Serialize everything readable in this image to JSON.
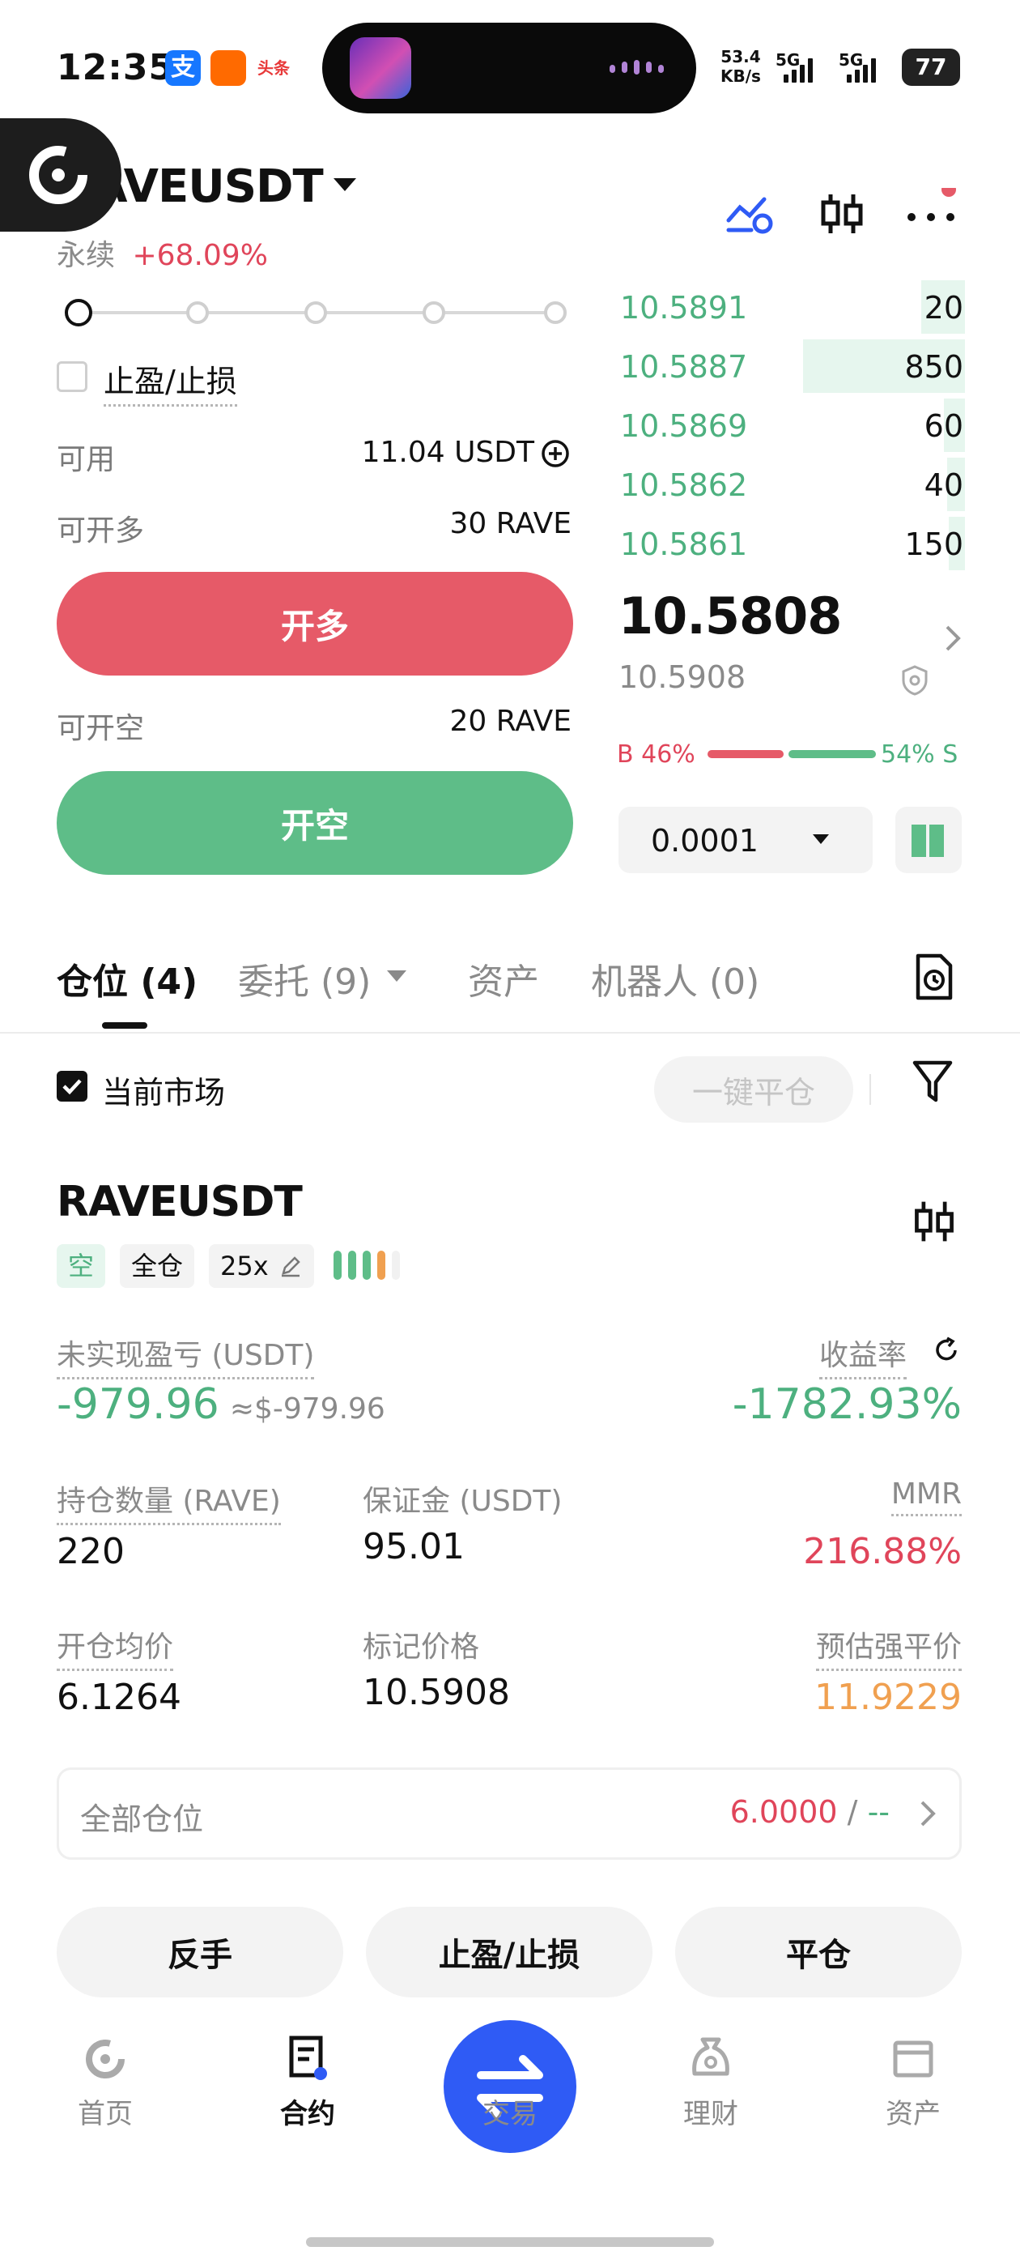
{
  "status_bar": {
    "time": "12:35",
    "net_speed_value": "53.4",
    "net_speed_unit": "KB/s",
    "signal1_label": "5G",
    "signal2_label": "5G",
    "battery": "77",
    "app_icons": [
      "alipay-icon",
      "taobao-icon",
      "toutiao-icon"
    ],
    "toutiao_label": "头条"
  },
  "header": {
    "pair": "RAVEUSDT",
    "contract_type": "永续",
    "change": "+68.09%"
  },
  "order_panel": {
    "tp_sl_label": "止盈/止损",
    "available_label": "可用",
    "available_value": "11.04 USDT",
    "can_long_label": "可开多",
    "can_long_value": "30 RAVE",
    "long_button": "开多",
    "can_short_label": "可开空",
    "can_short_value": "20 RAVE",
    "short_button": "开空",
    "leverage_slider_level": 0
  },
  "order_book": {
    "rows": [
      {
        "price": "10.5891",
        "qty": "20",
        "depth": 0.27
      },
      {
        "price": "10.5887",
        "qty": "850",
        "depth": 1.0
      },
      {
        "price": "10.5869",
        "qty": "60",
        "depth": 0.13
      },
      {
        "price": "10.5862",
        "qty": "40",
        "depth": 0.11
      },
      {
        "price": "10.5861",
        "qty": "150",
        "depth": 0.098
      }
    ],
    "last_price": "10.5808",
    "mark_price": "10.5908",
    "buy_ratio": "B 46%",
    "sell_ratio": "54% S",
    "tick_size": "0.0001"
  },
  "tabs": {
    "positions": "仓位 (4)",
    "orders": "委托 (9)",
    "assets": "资产",
    "bots": "机器人 (0)"
  },
  "filters": {
    "current_market": "当前市场",
    "close_all": "一键平仓"
  },
  "position": {
    "symbol": "RAVEUSDT",
    "side": "空",
    "margin_mode": "全仓",
    "leverage": "25x",
    "unrealized_label": "未实现盈亏 (USDT)",
    "unrealized_value": "-979.96",
    "unrealized_usd": "≈$-979.96",
    "roe_label": "收益率",
    "roe_value": "-1782.93%",
    "size_label": "持仓数量 (RAVE)",
    "size_value": "220",
    "margin_label": "保证金 (USDT)",
    "margin_value": "95.01",
    "mmr_label": "MMR",
    "mmr_value": "216.88%",
    "entry_label": "开仓均价",
    "entry_value": "6.1264",
    "mark_label": "标记价格",
    "mark_value": "10.5908",
    "liq_label": "预估强平价",
    "liq_value": "11.9229",
    "all_positions_label": "全部仓位",
    "all_positions_value": "6.0000",
    "all_positions_sep": "/",
    "all_positions_dash": "--",
    "reverse_button": "反手",
    "tpsl_button": "止盈/止损",
    "close_button": "平仓"
  },
  "bottom_nav": {
    "home": "首页",
    "contract": "合约",
    "trade": "交易",
    "finance": "理财",
    "assets": "资产"
  },
  "colors": {
    "red": "#e65a68",
    "green": "#5ebd88",
    "blue": "#2f5bf5",
    "orange": "#f0a050"
  }
}
